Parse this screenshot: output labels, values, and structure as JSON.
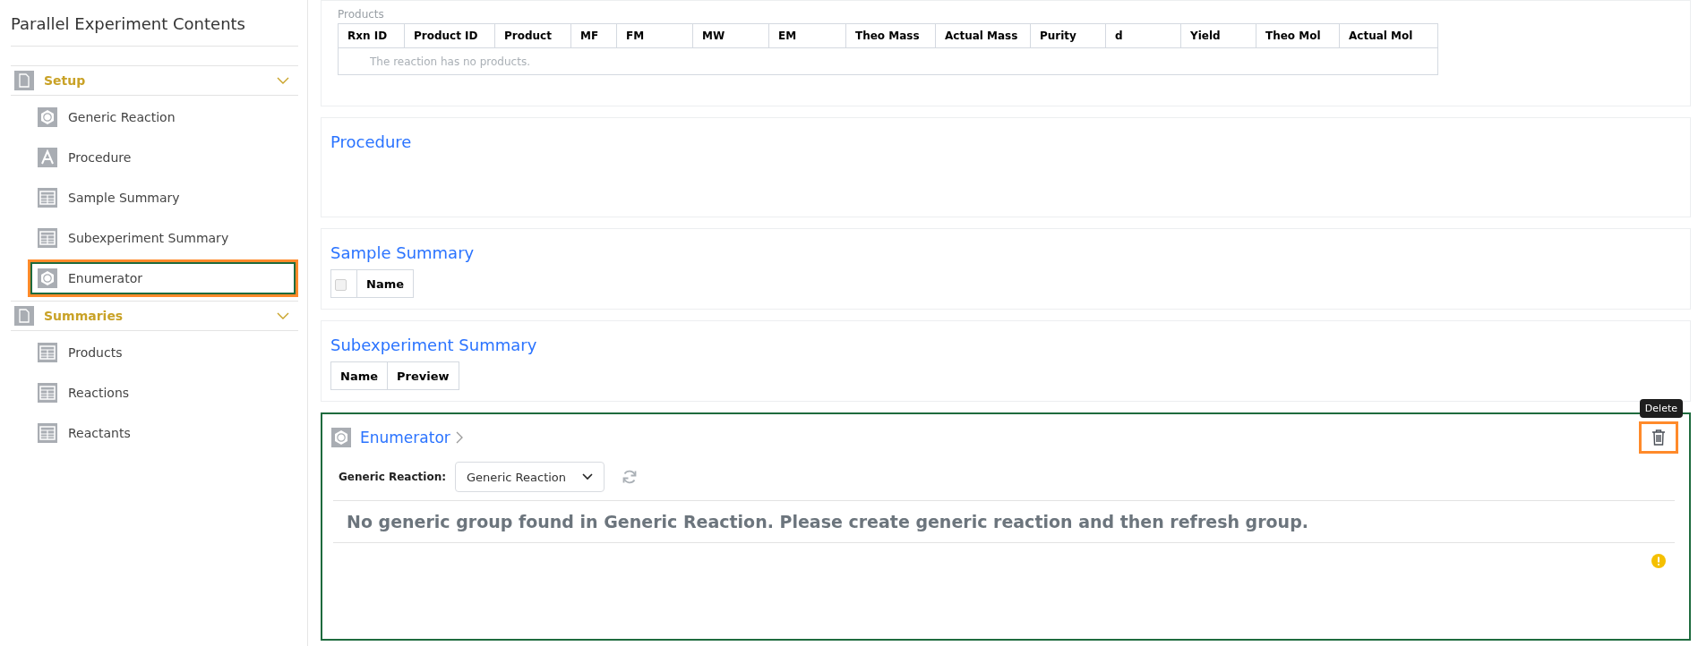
{
  "sidebar": {
    "title": "Parallel Experiment Contents",
    "groups": [
      {
        "label": "Setup",
        "expanded": true,
        "items": [
          {
            "label": "Generic Reaction",
            "kind": "reaction",
            "selected": false,
            "highlighted": false
          },
          {
            "label": "Procedure",
            "kind": "text",
            "selected": false,
            "highlighted": false
          },
          {
            "label": "Sample Summary",
            "kind": "table",
            "selected": false,
            "highlighted": false
          },
          {
            "label": "Subexperiment Summary",
            "kind": "table",
            "selected": false,
            "highlighted": false
          },
          {
            "label": "Enumerator",
            "kind": "reaction",
            "selected": true,
            "highlighted": true
          }
        ]
      },
      {
        "label": "Summaries",
        "expanded": true,
        "items": [
          {
            "label": "Products",
            "kind": "table",
            "selected": false,
            "highlighted": false
          },
          {
            "label": "Reactions",
            "kind": "table",
            "selected": false,
            "highlighted": false
          },
          {
            "label": "Reactants",
            "kind": "table",
            "selected": false,
            "highlighted": false
          }
        ]
      }
    ]
  },
  "products": {
    "label": "Products",
    "columns": [
      "Rxn ID",
      "Product ID",
      "Product",
      "MF",
      "FM",
      "MW",
      "EM",
      "Theo Mass",
      "Actual Mass",
      "Purity",
      "d",
      "Yield",
      "Theo Mol",
      "Actual Mol"
    ],
    "empty_message": "The reaction has no products."
  },
  "procedure": {
    "title": "Procedure"
  },
  "sample_summary": {
    "title": "Sample Summary",
    "select_all_checked": false,
    "columns": [
      "Name"
    ]
  },
  "subexperiment_summary": {
    "title": "Subexperiment Summary",
    "columns": [
      "Name",
      "Preview"
    ]
  },
  "enumerator": {
    "title": "Enumerator",
    "selected": true,
    "field_label": "Generic Reaction:",
    "dropdown_value": "Generic Reaction",
    "message": "No generic group found in Generic Reaction. Please create generic reaction and then refresh group.",
    "delete_tooltip": "Delete",
    "delete_highlighted": true,
    "warning": true
  }
}
